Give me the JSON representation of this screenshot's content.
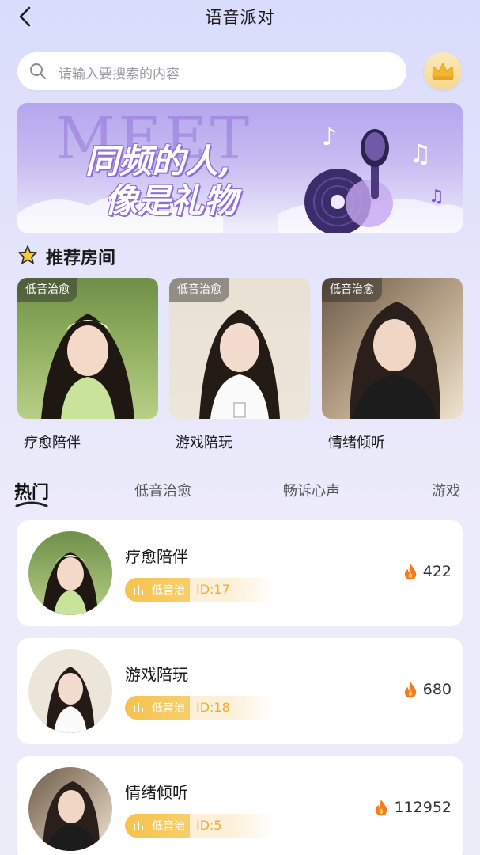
{
  "header": {
    "title": "语音派对",
    "back_icon": "chevron-left-icon"
  },
  "search": {
    "placeholder": "请输入要搜索的内容",
    "icon": "search-icon"
  },
  "crown": {
    "icon": "crown-icon",
    "color": "#f5c84f"
  },
  "banner": {
    "bg_word": "MEET",
    "line1": "同频的人,",
    "line2": "像是礼物",
    "art": "microphone-record-icon"
  },
  "recommend": {
    "title": "推荐房间",
    "icon": "star-icon",
    "cards": [
      {
        "tag": "低音治愈",
        "name": "疗愈陪伴"
      },
      {
        "tag": "低音治愈",
        "name": "游戏陪玩"
      },
      {
        "tag": "低音治愈",
        "name": "情绪倾听"
      }
    ]
  },
  "tabs": [
    {
      "label": "热门",
      "active": true
    },
    {
      "label": "低音治愈",
      "active": false
    },
    {
      "label": "畅诉心声",
      "active": false
    },
    {
      "label": "游戏",
      "active": false
    }
  ],
  "rooms": [
    {
      "name": "疗愈陪伴",
      "tag": "低音治",
      "id": "ID:17",
      "heat": "422"
    },
    {
      "name": "游戏陪玩",
      "tag": "低音治",
      "id": "ID:18",
      "heat": "680"
    },
    {
      "name": "情绪倾听",
      "tag": "低音治",
      "id": "ID:5",
      "heat": "112952"
    }
  ],
  "colors": {
    "accent": "#f6c24c",
    "id_text": "#f0ae2c",
    "fire": "#f57b1f",
    "banner": "#b5a6ee"
  }
}
